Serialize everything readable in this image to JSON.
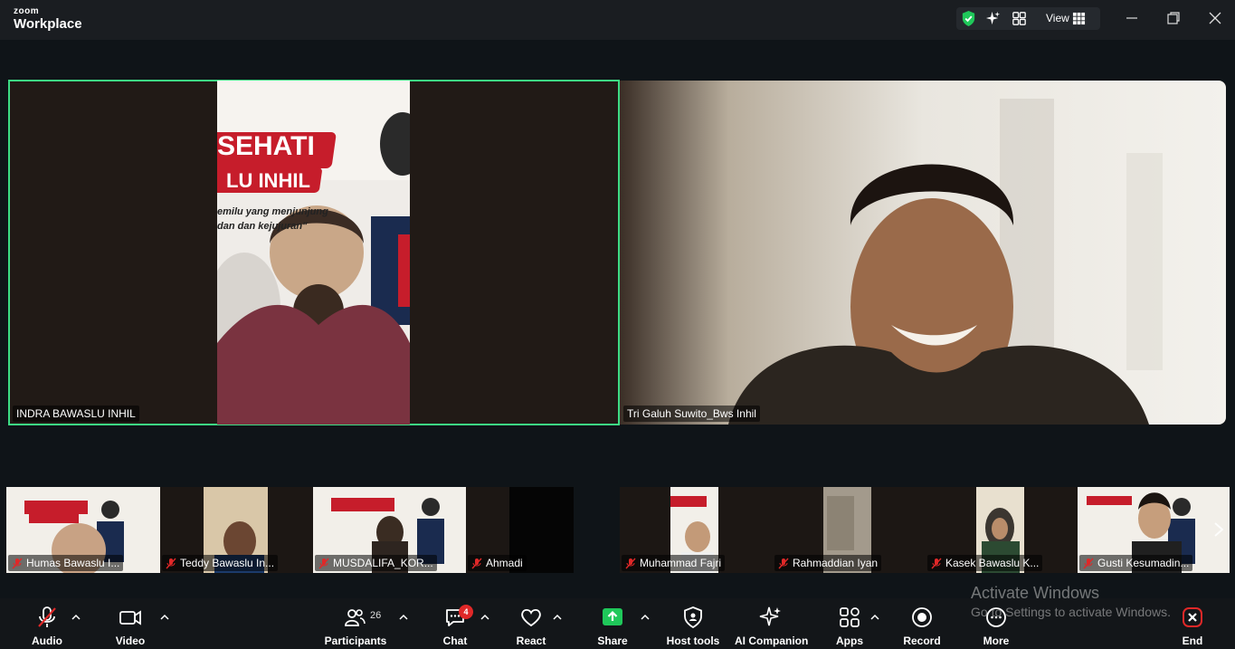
{
  "app": {
    "brand_small": "zoom",
    "brand_large": "Workplace",
    "view_label": "View"
  },
  "main_tiles": [
    {
      "name": "INDRA BAWASLU INHIL",
      "active": true
    },
    {
      "name": "Tri Galuh Suwito_Bws Inhil",
      "active": false
    }
  ],
  "banner": {
    "title": "SEHATI",
    "subtitle": "LU INHIL",
    "line1": "emilu yang menjunjung",
    "line2": "dan dan kejujuran\""
  },
  "thumbnails": [
    {
      "name": "Humas Bawaslu I..."
    },
    {
      "name": "Teddy Bawaslu In..."
    },
    {
      "name": "MUSDALIFA_KOR..."
    },
    {
      "name": "Ahmadi"
    },
    {
      "name": "Muhammad Fajri"
    },
    {
      "name": "Rahmaddian Iyan"
    },
    {
      "name": "Kasek Bawaslu K..."
    },
    {
      "name": "Gusti Kesumadin..."
    }
  ],
  "toolbar": {
    "audio": "Audio",
    "video": "Video",
    "participants": "Participants",
    "participants_count": "26",
    "chat": "Chat",
    "chat_badge": "4",
    "react": "React",
    "share": "Share",
    "host_tools": "Host tools",
    "ai_companion": "AI Companion",
    "apps": "Apps",
    "record": "Record",
    "more": "More",
    "end": "End"
  },
  "watermark": {
    "title": "Activate Windows",
    "subtitle": "Go to Settings to activate Windows."
  },
  "colors": {
    "active_border": "#3ddc84",
    "share_green": "#1fc85a",
    "end_red": "#e02828"
  }
}
